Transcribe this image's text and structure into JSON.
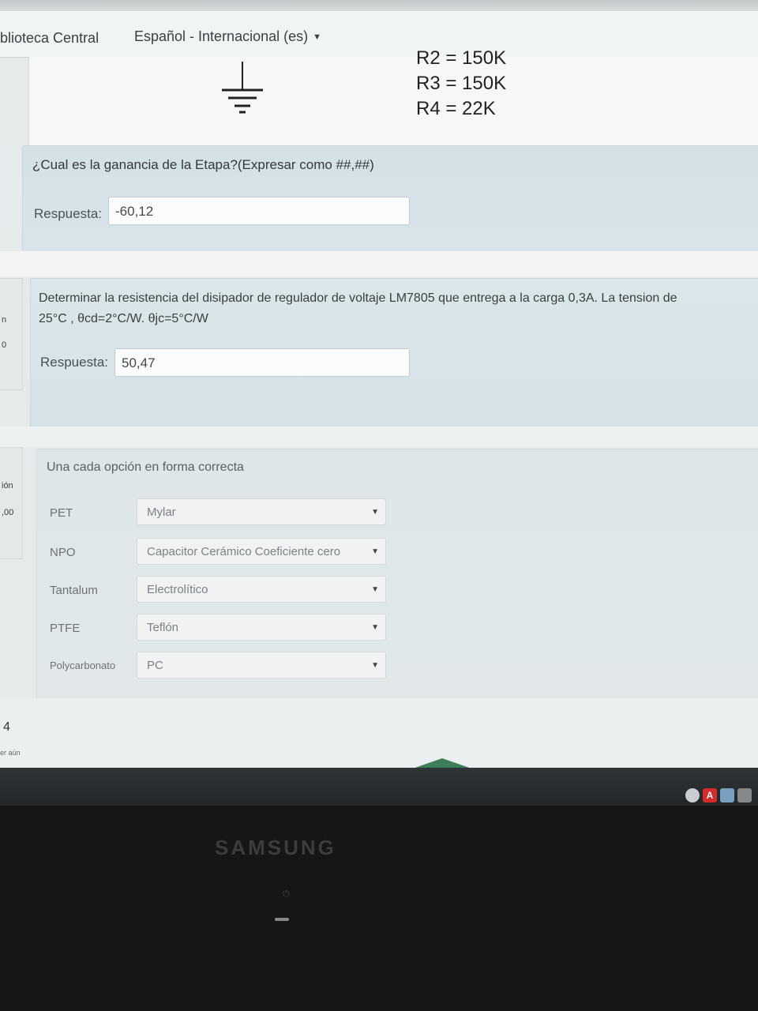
{
  "nav": {
    "library": "iblioteca Central",
    "language": "Español - Internacional (es)"
  },
  "q1": {
    "resistors": [
      "R2 = 150K",
      "R3 = 150K",
      "R4 = 22K"
    ],
    "question": "¿Cual es la ganancia de la Etapa?(Expresar como ##,##)",
    "answer_label": "Respuesta:",
    "answer_value": "-60,12"
  },
  "q2": {
    "question_line1": "Determinar la resistencia del disipador de regulador de voltaje LM7805 que entrega a la carga 0,3A. La tension de",
    "question_line2": "25°C , θcd=2°C/W. θjc=5°C/W",
    "answer_label": "Respuesta:",
    "answer_value": "50,47"
  },
  "q3": {
    "instruction": "Una cada opción en forma correcta",
    "pairs": [
      {
        "term": "PET",
        "selected": "Mylar"
      },
      {
        "term": "NPO",
        "selected": "Capacitor Cerámico Coeficiente cero"
      },
      {
        "term": "Tantalum",
        "selected": "Electrolítico"
      },
      {
        "term": "PTFE",
        "selected": "Teflón"
      },
      {
        "term": "Polycarbonato",
        "selected": "PC"
      }
    ]
  },
  "side": {
    "tab2_a": "n",
    "tab2_b": "0",
    "tab3_a": "ión",
    "tab3_b": ",00"
  },
  "q4": {
    "number": "4",
    "sub": "er aún"
  },
  "monitor": {
    "brand": "SAMSUNG"
  },
  "tray": {
    "acrobat_glyph": "A"
  }
}
